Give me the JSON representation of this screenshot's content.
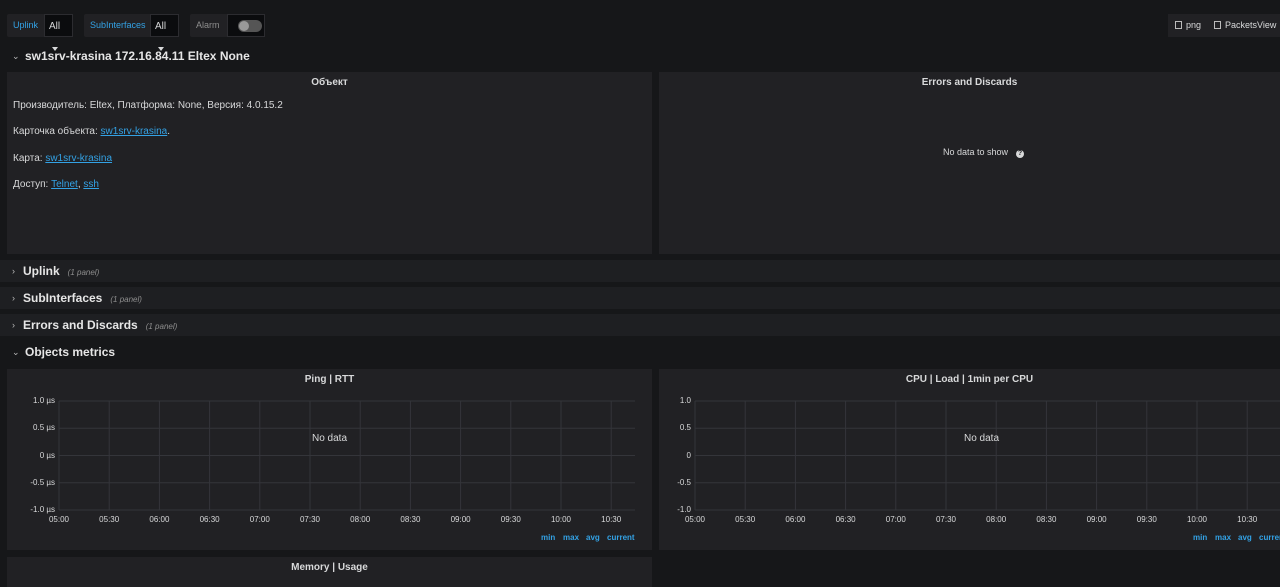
{
  "variables": {
    "uplink": {
      "label": "Uplink",
      "value": "All"
    },
    "subinterfaces": {
      "label": "SubInterfaces",
      "value": "All"
    },
    "alarm": {
      "label": "Alarm",
      "enabled": false
    }
  },
  "toolbar": {
    "png_label": "png",
    "packetsview_label": "PacketsView"
  },
  "device_row": {
    "title": "sw1srv-krasina 172.16.84.11 Eltex None"
  },
  "object_panel": {
    "title": "Объект",
    "manufacturer_line": "Производитель: Eltex, Платформа: None, Версия: 4.0.15.2",
    "card_label": "Карточка объекта: ",
    "card_link": "sw1srv-krasina",
    "card_suffix": ".",
    "map_label": "Карта: ",
    "map_link": "sw1srv-krasina",
    "access_label": "Доступ: ",
    "access_telnet": "Telnet",
    "access_sep": ", ",
    "access_ssh": "ssh"
  },
  "errors_panel": {
    "title": "Errors and Discards",
    "empty_text": "No data to show"
  },
  "rows": [
    {
      "title": "Uplink",
      "count": "(1 panel)"
    },
    {
      "title": "SubInterfaces",
      "count": "(1 panel)"
    },
    {
      "title": "Errors and Discards",
      "count": "(1 panel)"
    }
  ],
  "metrics_row": {
    "title": "Objects metrics"
  },
  "ping_panel": {
    "title": "Ping | RTT",
    "empty_text": "No data"
  },
  "cpu_panel": {
    "title": "CPU | Load | 1min per CPU",
    "empty_text": "No data"
  },
  "memory_panel": {
    "title": "Memory | Usage"
  },
  "legend": {
    "min": "min",
    "max": "max",
    "avg": "avg",
    "current": "current"
  },
  "chart_data": [
    {
      "type": "line",
      "title": "Ping | RTT",
      "x": [
        "05:00",
        "05:30",
        "06:00",
        "06:30",
        "07:00",
        "07:30",
        "08:00",
        "08:30",
        "09:00",
        "09:30",
        "10:00",
        "10:30"
      ],
      "y_ticks": [
        "1.0 µs",
        "0.5 µs",
        "0 µs",
        "-0.5 µs",
        "-1.0 µs"
      ],
      "ylim": [
        -1.0,
        1.0
      ],
      "series": []
    },
    {
      "type": "line",
      "title": "CPU | Load | 1min per CPU",
      "x": [
        "05:00",
        "05:30",
        "06:00",
        "06:30",
        "07:00",
        "07:30",
        "08:00",
        "08:30",
        "09:00",
        "09:30",
        "10:00",
        "10:30"
      ],
      "y_ticks": [
        "1.0",
        "0.5",
        "0",
        "-0.5",
        "-1.0"
      ],
      "ylim": [
        -1.0,
        1.0
      ],
      "series": []
    }
  ]
}
